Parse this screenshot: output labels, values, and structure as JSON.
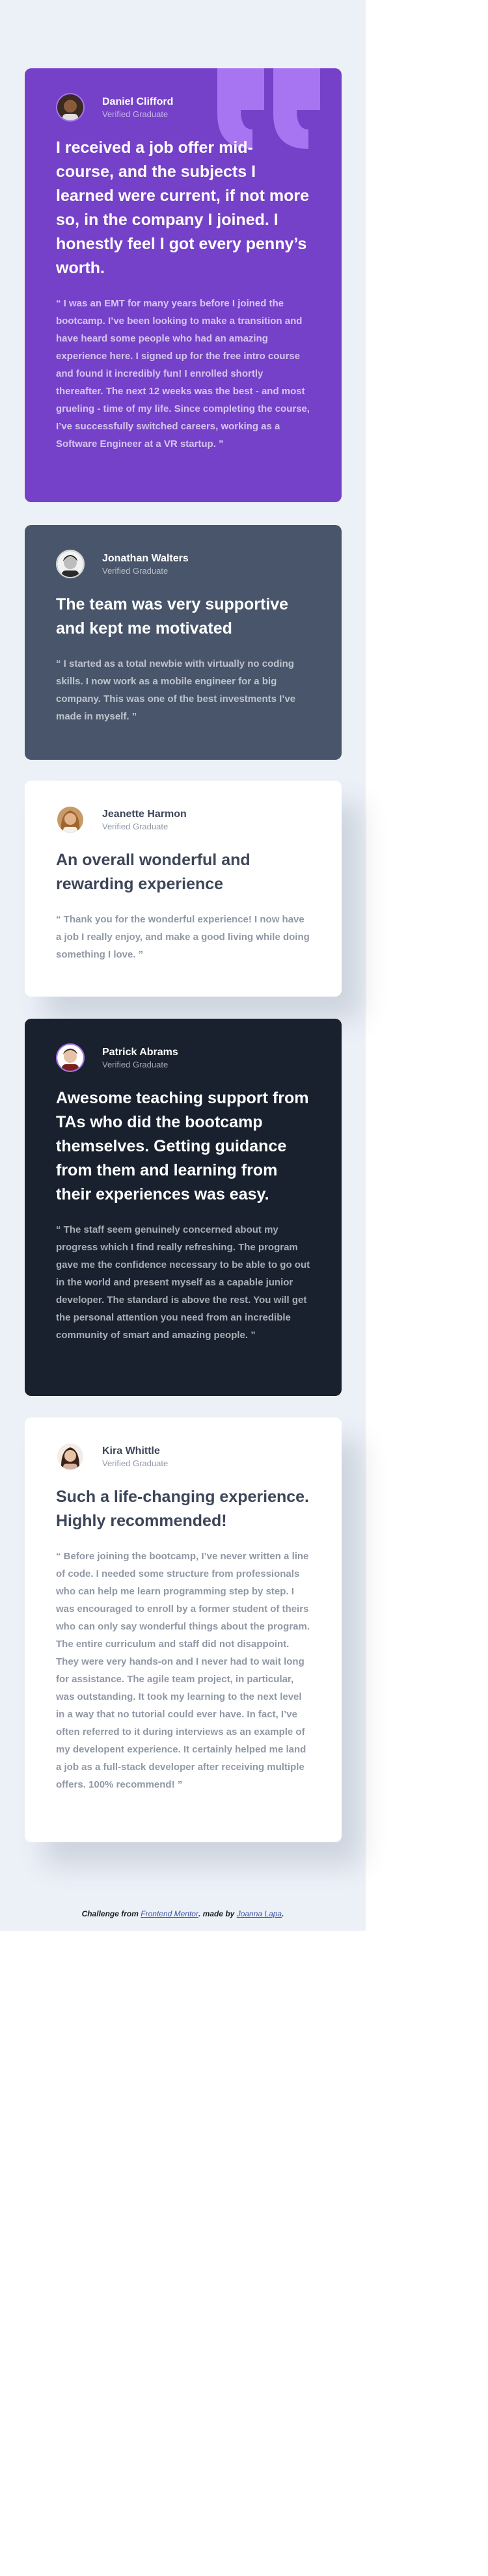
{
  "testimonials": [
    {
      "name": "Daniel Clifford",
      "role": "Verified Graduate",
      "headline": "I received a job offer mid-course, and the subjects I learned were current, if not more so, in the company I joined. I honestly feel I got every penny’s worth.",
      "body": "“ I was an EMT for many years before I joined the bootcamp. I’ve been looking to make a transition and have heard some people who had an amazing experience here. I signed up for the free intro course and found it incredibly fun! I enrolled shortly thereafter. The next 12 weeks was the best - and most grueling - time of my life. Since completing the course, I’ve successfully switched careers, working as a Software Engineer at a VR startup. ”",
      "colors": {
        "bg": "#7541c8",
        "avatar_skin": "#8a5a3c",
        "avatar_hair": "#2b1a12"
      }
    },
    {
      "name": "Jonathan Walters",
      "role": "Verified Graduate",
      "headline": "The team was very supportive and kept me motivated",
      "body": "“ I started as a total newbie with virtually no coding skills. I now work as a mobile engineer for a big company. This was one of the best investments I’ve made in myself. ”",
      "colors": {
        "bg": "#48556a",
        "avatar_skin": "#d9d9d9",
        "avatar_hair": "#1c1c1c"
      }
    },
    {
      "name": "Jeanette Harmon",
      "role": "Verified Graduate",
      "headline": "An overall wonderful and rewarding experience",
      "body": "“ Thank you for the wonderful experience! I now have a job I really enjoy, and make a good living while doing something I love. ”",
      "colors": {
        "bg": "#ffffff",
        "avatar_skin": "#e1b48c",
        "avatar_hair": "#a0642c"
      }
    },
    {
      "name": "Patrick Abrams",
      "role": "Verified Graduate",
      "headline": "Awesome teaching support from TAs who did the bootcamp themselves. Getting guidance from them and learning from their experiences was easy.",
      "body": "“ The staff seem genuinely concerned about my progress which I find really refreshing. The program gave me the confidence necessary to be able to go out in the world and present myself as a capable junior developer. The standard is above the rest. You will get the personal attention you need from an incredible community of smart and amazing people. ”",
      "colors": {
        "bg": "#19212e",
        "avatar_skin": "#e6c2a8",
        "avatar_hair": "#3b2418"
      }
    },
    {
      "name": "Kira Whittle",
      "role": "Verified Graduate",
      "headline": "Such a life-changing experience. Highly recommended!",
      "body": "“ Before joining the bootcamp, I’ve never written a line of code. I needed some structure from professionals who can help me learn programming step by step. I was encouraged to enroll by a former student of theirs who can only say wonderful things about the program. The entire curriculum and staff did not disappoint. They were very hands-on and I never had to wait long for assistance. The agile team project, in particular, was outstanding. It took my learning to the next level in a way that no tutorial could ever have. In fact, I’ve often referred to it during interviews as an example of my developent experience. It certainly helped me land a job as a full-stack developer after receiving multiple offers. 100% recommend! ”",
      "colors": {
        "bg": "#ffffff",
        "avatar_skin": "#e9c3a6",
        "avatar_hair": "#3a2218"
      }
    }
  ],
  "attribution": {
    "prefix": "Challenge from",
    "link1": "Frontend Mentor",
    "middle": "made by",
    "link2": "Joanna Lapa"
  },
  "colors": {
    "page_bg": "#ecf1f8",
    "quote_mark": "#a775f1",
    "heading_dark": "#3d4659",
    "text_gray": "#48556a"
  },
  "icons": {
    "quote": "quotation-mark-icon"
  }
}
